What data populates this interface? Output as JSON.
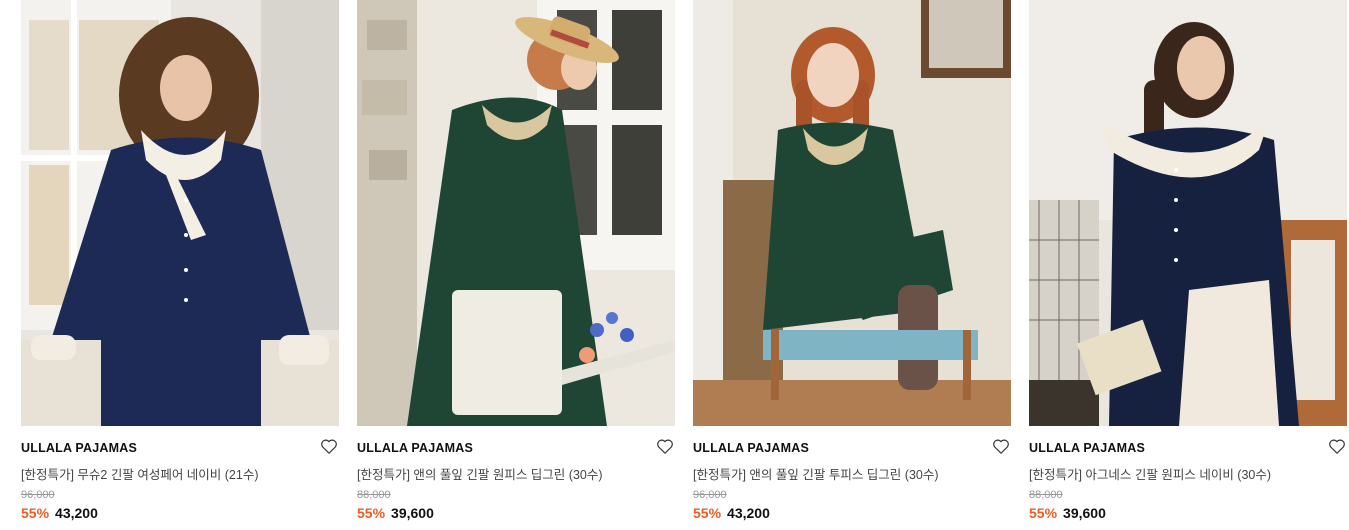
{
  "products": [
    {
      "brand": "ULLALA PAJAMAS",
      "title": "[한정특가] 무슈2 긴팔 여성페어 네이비 (21수)",
      "original_price": "96,000",
      "discount": "55%",
      "price": "43,200",
      "image": "navy-pajama-set-model"
    },
    {
      "brand": "ULLALA PAJAMAS",
      "title": "[한정특가] 앤의 풀잎 긴팔 원피스 딥그린 (30수)",
      "original_price": "88,000",
      "discount": "55%",
      "price": "39,600",
      "image": "green-dress-watering-can-model"
    },
    {
      "brand": "ULLALA PAJAMAS",
      "title": "[한정특가] 앤의 풀잎 긴팔 투피스 딥그린 (30수)",
      "original_price": "96,000",
      "discount": "55%",
      "price": "43,200",
      "image": "green-two-piece-chair-model"
    },
    {
      "brand": "ULLALA PAJAMAS",
      "title": "[한정특가] 아그네스 긴팔 원피스 네이비 (30수)",
      "original_price": "88,000",
      "discount": "55%",
      "price": "39,600",
      "image": "navy-dress-chair-model"
    }
  ],
  "colors": {
    "discount": "#ef5b22",
    "navy": "#1c2a55",
    "deep_green": "#1f4634"
  }
}
